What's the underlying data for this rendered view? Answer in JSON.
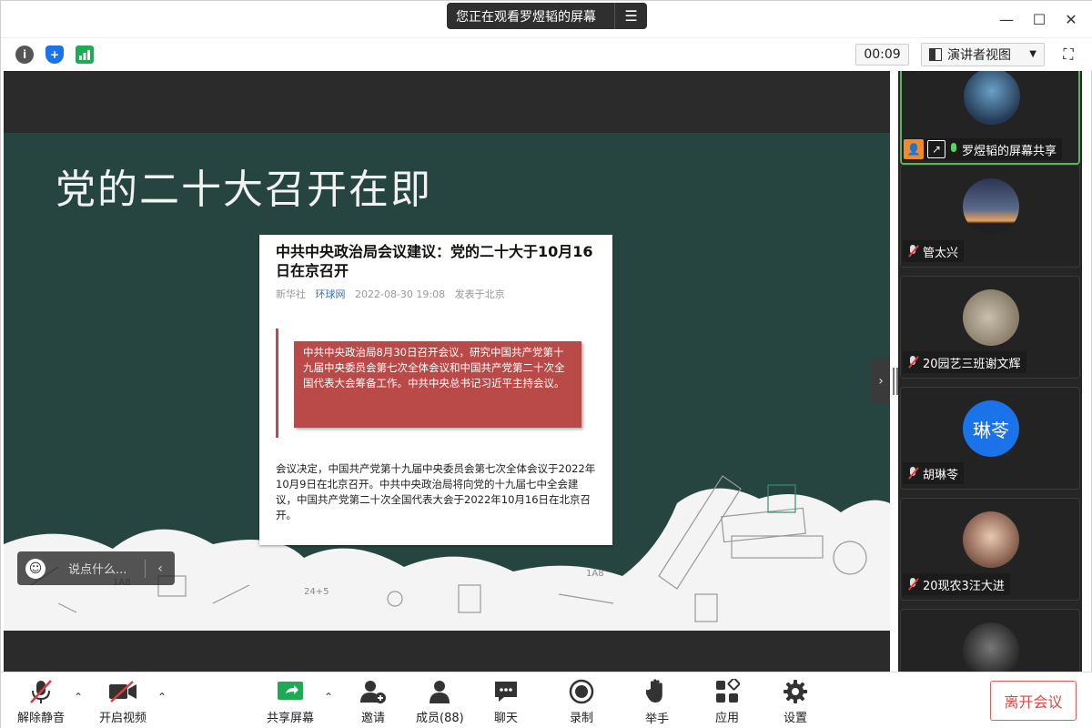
{
  "titlebar": {
    "sharing_notice": "您正在观看罗煜韬的屏幕",
    "menu_icon": "list-icon",
    "minimize_icon": "minimize-icon",
    "maximize_icon": "maximize-icon",
    "close_icon": "close-icon"
  },
  "infobar": {
    "info_icon": "info-icon",
    "security_icon": "shield-icon",
    "network_icon": "signal-bars-icon",
    "timer": "00:09",
    "view_mode": "演讲者视图",
    "fullscreen_icon": "fullscreen-icon"
  },
  "slide": {
    "title": "党的二十大召开在即",
    "article": {
      "headline": "中共中央政治局会议建议：党的二十大于10月16日在京召开",
      "meta_source": "新华社",
      "meta_site": "环球网",
      "meta_date": "2022-08-30 19:08",
      "meta_location": "发表于北京",
      "quote": "中共中央政治局8月30日召开会议，研究中国共产党第十九届中央委员会第七次全体会议和中国共产党第二十次全国代表大会筹备工作。中共中央总书记习近平主持会议。",
      "body": "会议决定，中国共产党第十九届中央委员会第七次全体会议于2022年10月9日在北京召开。中共中央政治局将向党的十九届七中全会建议，中国共产党第二十次全国代表大会于2022年10月16日在北京召开。"
    }
  },
  "chat": {
    "placeholder": "说点什么..."
  },
  "gallery": {
    "participants": [
      {
        "name": "罗煜韬的屏幕共享",
        "mic": "on",
        "sharing": true
      },
      {
        "name": "管太兴",
        "mic": "muted"
      },
      {
        "name": "20园艺三班谢文辉",
        "mic": "muted"
      },
      {
        "name": "胡琳苓",
        "mic": "muted",
        "avatar_text": "琳苓",
        "avatar_color": "#1a73e8"
      },
      {
        "name": "20现农3汪大进",
        "mic": "muted"
      }
    ]
  },
  "toolbar": {
    "unmute": "解除静音",
    "start_video": "开启视频",
    "share_screen": "共享屏幕",
    "invite": "邀请",
    "members": "成员(88)",
    "chat": "聊天",
    "record": "录制",
    "raise_hand": "举手",
    "apps": "应用",
    "settings": "设置",
    "leave": "离开会议"
  },
  "colors": {
    "slide_bg": "#264541",
    "quote_bg": "#b94a47",
    "leave_red": "#e04545",
    "active_border": "#5ab35d",
    "share_green": "#1faa53"
  }
}
